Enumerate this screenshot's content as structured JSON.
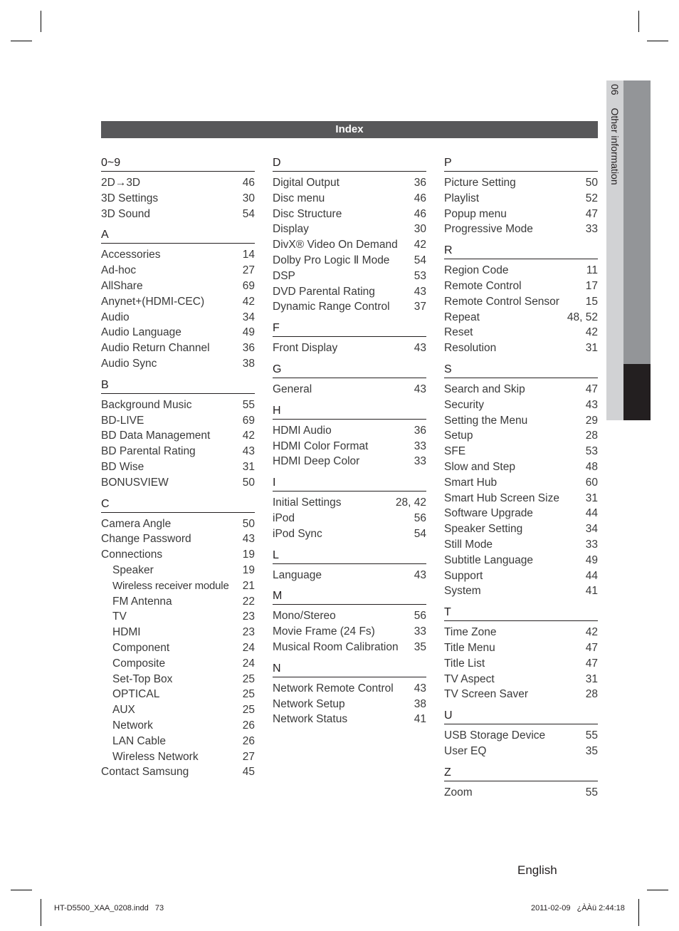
{
  "header": {
    "title": "Index"
  },
  "side_tab": {
    "chapter_number": "06",
    "chapter_title": "Other information"
  },
  "columns": [
    {
      "sections": [
        {
          "letter": "0~9",
          "entries": [
            {
              "term": "2D→3D",
              "page": "46"
            },
            {
              "term": "3D Settings",
              "page": "30"
            },
            {
              "term": "3D Sound",
              "page": "54"
            }
          ]
        },
        {
          "letter": "A",
          "entries": [
            {
              "term": "Accessories",
              "page": "14"
            },
            {
              "term": "Ad-hoc",
              "page": "27"
            },
            {
              "term": "AllShare",
              "page": "69"
            },
            {
              "term": "Anynet+(HDMI-CEC)",
              "page": "42"
            },
            {
              "term": "Audio",
              "page": "34"
            },
            {
              "term": "Audio Language",
              "page": "49"
            },
            {
              "term": "Audio Return Channel",
              "page": "36"
            },
            {
              "term": "Audio Sync",
              "page": "38"
            }
          ]
        },
        {
          "letter": "B",
          "entries": [
            {
              "term": "Background Music",
              "page": "55"
            },
            {
              "term": "BD-LIVE",
              "page": "69"
            },
            {
              "term": "BD Data Management",
              "page": "42"
            },
            {
              "term": "BD Parental Rating",
              "page": "43"
            },
            {
              "term": "BD Wise",
              "page": "31"
            },
            {
              "term": "BONUSVIEW",
              "page": "50"
            }
          ]
        },
        {
          "letter": "C",
          "entries": [
            {
              "term": "Camera Angle",
              "page": "50"
            },
            {
              "term": "Change Password",
              "page": "43"
            },
            {
              "term": "Connections",
              "page": "19"
            },
            {
              "term": "Speaker",
              "page": "19",
              "sub": true
            },
            {
              "term": "Wireless receiver module",
              "page": "21",
              "sub": true
            },
            {
              "term": "FM Antenna",
              "page": "22",
              "sub": true
            },
            {
              "term": "TV",
              "page": "23",
              "sub": true
            },
            {
              "term": "HDMI",
              "page": "23",
              "sub": true
            },
            {
              "term": "Component",
              "page": "24",
              "sub": true
            },
            {
              "term": "Composite",
              "page": "24",
              "sub": true
            },
            {
              "term": "Set-Top Box",
              "page": "25",
              "sub": true
            },
            {
              "term": "OPTICAL",
              "page": "25",
              "sub": true
            },
            {
              "term": "AUX",
              "page": "25",
              "sub": true
            },
            {
              "term": "Network",
              "page": "26",
              "sub": true
            },
            {
              "term": "LAN Cable",
              "page": "26",
              "sub": true
            },
            {
              "term": "Wireless Network",
              "page": "27",
              "sub": true
            },
            {
              "term": "Contact Samsung",
              "page": "45"
            }
          ]
        }
      ]
    },
    {
      "sections": [
        {
          "letter": "D",
          "entries": [
            {
              "term": "Digital Output",
              "page": "36"
            },
            {
              "term": "Disc menu",
              "page": "46"
            },
            {
              "term": "Disc Structure",
              "page": "46"
            },
            {
              "term": "Display",
              "page": "30"
            },
            {
              "term": "DivX® Video On Demand",
              "page": "42"
            },
            {
              "term": "Dolby Pro Logic Ⅱ Mode",
              "page": "54"
            },
            {
              "term": "DSP",
              "page": "53"
            },
            {
              "term": "DVD Parental Rating",
              "page": "43"
            },
            {
              "term": "Dynamic Range Control",
              "page": "37"
            }
          ]
        },
        {
          "letter": "F",
          "entries": [
            {
              "term": "Front Display",
              "page": "43"
            }
          ]
        },
        {
          "letter": "G",
          "entries": [
            {
              "term": "General",
              "page": "43"
            }
          ]
        },
        {
          "letter": "H",
          "entries": [
            {
              "term": "HDMI Audio",
              "page": "36"
            },
            {
              "term": "HDMI Color Format",
              "page": "33"
            },
            {
              "term": "HDMI Deep Color",
              "page": "33"
            }
          ]
        },
        {
          "letter": "I",
          "entries": [
            {
              "term": "Initial Settings",
              "page": "28, 42"
            },
            {
              "term": "iPod",
              "page": "56"
            },
            {
              "term": "iPod Sync",
              "page": "54"
            }
          ]
        },
        {
          "letter": "L",
          "entries": [
            {
              "term": "Language",
              "page": "43"
            }
          ]
        },
        {
          "letter": "M",
          "entries": [
            {
              "term": "Mono/Stereo",
              "page": "56"
            },
            {
              "term": "Movie Frame (24 Fs)",
              "page": "33"
            },
            {
              "term": "Musical Room Calibration",
              "page": "35"
            }
          ]
        },
        {
          "letter": "N",
          "entries": [
            {
              "term": "Network Remote Control",
              "page": "43"
            },
            {
              "term": "Network Setup",
              "page": "38"
            },
            {
              "term": "Network Status",
              "page": "41"
            }
          ]
        }
      ]
    },
    {
      "sections": [
        {
          "letter": "P",
          "entries": [
            {
              "term": "Picture Setting",
              "page": "50"
            },
            {
              "term": "Playlist",
              "page": "52"
            },
            {
              "term": "Popup menu",
              "page": "47"
            },
            {
              "term": "Progressive Mode",
              "page": "33"
            }
          ]
        },
        {
          "letter": "R",
          "entries": [
            {
              "term": "Region Code",
              "page": "11"
            },
            {
              "term": "Remote Control",
              "page": "17"
            },
            {
              "term": "Remote Control Sensor",
              "page": "15"
            },
            {
              "term": "Repeat",
              "page": "48, 52"
            },
            {
              "term": "Reset",
              "page": "42"
            },
            {
              "term": "Resolution",
              "page": "31"
            }
          ]
        },
        {
          "letter": "S",
          "entries": [
            {
              "term": "Search and Skip",
              "page": "47"
            },
            {
              "term": "Security",
              "page": "43"
            },
            {
              "term": "Setting the Menu",
              "page": "29"
            },
            {
              "term": "Setup",
              "page": "28"
            },
            {
              "term": "SFE",
              "page": "53"
            },
            {
              "term": "Slow and Step",
              "page": "48"
            },
            {
              "term": "Smart Hub",
              "page": "60"
            },
            {
              "term": "Smart Hub Screen Size",
              "page": "31"
            },
            {
              "term": "Software Upgrade",
              "page": "44"
            },
            {
              "term": "Speaker Setting",
              "page": "34"
            },
            {
              "term": "Still Mode",
              "page": "33"
            },
            {
              "term": "Subtitle Language",
              "page": "49"
            },
            {
              "term": "Support",
              "page": "44"
            },
            {
              "term": "System",
              "page": "41"
            }
          ]
        },
        {
          "letter": "T",
          "entries": [
            {
              "term": "Time Zone",
              "page": "42"
            },
            {
              "term": "Title Menu",
              "page": "47"
            },
            {
              "term": "Title List",
              "page": "47"
            },
            {
              "term": "TV Aspect",
              "page": "31"
            },
            {
              "term": "TV Screen Saver",
              "page": "28"
            }
          ]
        },
        {
          "letter": "U",
          "entries": [
            {
              "term": "USB Storage Device",
              "page": "55"
            },
            {
              "term": "User EQ",
              "page": "35"
            }
          ]
        },
        {
          "letter": "Z",
          "entries": [
            {
              "term": "Zoom",
              "page": "55"
            }
          ]
        }
      ]
    }
  ],
  "footer": {
    "language": "English",
    "file_info": "HT-D5500_XAA_0208.indd   73",
    "timestamp": "2011-02-09   ¿ÀÀü 2:44:18"
  }
}
